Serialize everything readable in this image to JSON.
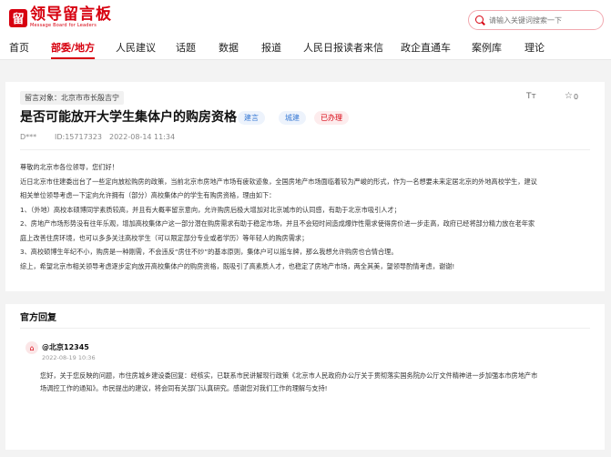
{
  "header": {
    "logo_mark": "留",
    "logo_cn": "领导留言板",
    "logo_en": "Message Board for Leaders",
    "search_placeholder": "请输入关键词搜索一下"
  },
  "nav": {
    "items": [
      "首页",
      "部委/地方",
      "人民建议",
      "话题",
      "数据",
      "报道",
      "人民日报读者来信",
      "政企直通车",
      "案例库",
      "理论"
    ]
  },
  "post": {
    "target": "留言对象：北京市市长殷吉宁",
    "font_toggle": "Tт",
    "star_icon": "☆",
    "star_count": "0",
    "title": "是否可能放开大学生集体户的购房资格",
    "tags": [
      "建言",
      "城建",
      "已办理"
    ],
    "author": "D***",
    "id": "ID:15717323",
    "time": "2022-08-14 11:34",
    "body": [
      "尊敬的北京市各位领导，您们好！",
      "近日北京市住建委出台了一些定向放松购房的政策，当前北京市房地产市场有疲软迹象，全国房地产市场面临着较为严峻的形式，作为一名想要未来定居北京的外地高校学生，建议",
      "相关单位领导考虑一下定向允许拥有（部分）高校集体户的学生有购房资格，理由如下：",
      "1、（外地）高校本硕博同学素质较高，并且有大概率留京意向，允许购房后极大增加对北京城市的认同感，有助于北京市吸引人才；",
      "2、房地产市场形势没有往年乐观，增加高校集体户这一部分潜在购房需求有助于稳定市场，并且不会短时间造成爆炸性需求使得房价进一步走高，政府已经将部分精力放在老年家",
      "庭上改善住房环境，也可以多多关注高校学生（可以限定部分专业或者学历）等年轻人的购房需求；",
      "3、高校硕博生年纪不小，购房是一种刚需，不会违反“房住不炒”的基本原则，集体户可以摇车牌，那么我想允许购房也合情合理。",
      "综上，希望北京市相关领导考虑逐步定向放开高校集体户的购房资格，既吸引了高素质人才，也稳定了房地产市场，两全其美，望领导酌情考虑，谢谢!"
    ]
  },
  "reply": {
    "header": "官方回复",
    "gov_icon": "⌂",
    "author": "@北京12345",
    "date": "2022-08-19 10:36",
    "body": [
      "您好，关于您反映的问题，市住房城乡建设委回复：经核实，已联系市民讲解现行政策《北京市人民政府办公厅关于贯彻落实国务院办公厅文件精神进一步加强本市房地产市",
      "场调控工作的通知》。市民提出的建议，将会同有关部门认真研究。感谢您对我们工作的理解与支持!"
    ]
  },
  "colors": {
    "brand": "#d7000f",
    "tag_blue": "#3a7bd5"
  }
}
